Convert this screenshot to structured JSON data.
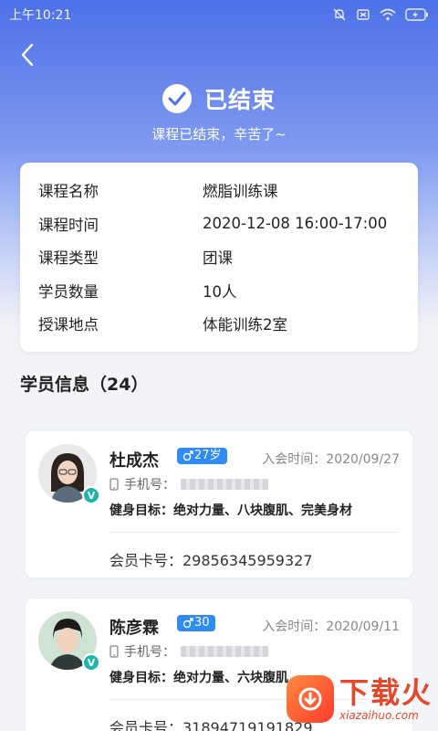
{
  "status_bar": {
    "time": "上午10:21"
  },
  "header": {
    "title": "已结束",
    "subtitle": "课程已结束，辛苦了~"
  },
  "course_info": [
    {
      "key": "课程名称",
      "value": "燃脂训练课"
    },
    {
      "key": "课程时间",
      "value": "2020-12-08 16:00-17:00"
    },
    {
      "key": "课程类型",
      "value": "团课"
    },
    {
      "key": "学员数量",
      "value": "10人"
    },
    {
      "key": "授课地点",
      "value": "体能训练2室"
    }
  ],
  "members_section": {
    "title": "学员信息（24）"
  },
  "members": [
    {
      "name": "杜成杰",
      "age": "27岁",
      "join_time": "入会时间：2020/09/27",
      "phone_label": "手机号：",
      "goal": "健身目标：绝对力量、八块腹肌、完美身材",
      "card_no": "会员卡号：29856345959327",
      "badge": "V"
    },
    {
      "name": "陈彦霖",
      "age": "30",
      "join_time": "入会时间：2020/09/11",
      "phone_label": "手机号：",
      "goal": "健身目标：绝对力量、六块腹肌",
      "card_no": "会员卡号：31894719191829",
      "badge": "V"
    }
  ],
  "watermark": {
    "big": "下载火",
    "small": "xiazaihuo.com"
  },
  "colors": {
    "accent": "#4d71e8",
    "tag": "#2f8bf1",
    "badge": "#1cb5b0"
  }
}
